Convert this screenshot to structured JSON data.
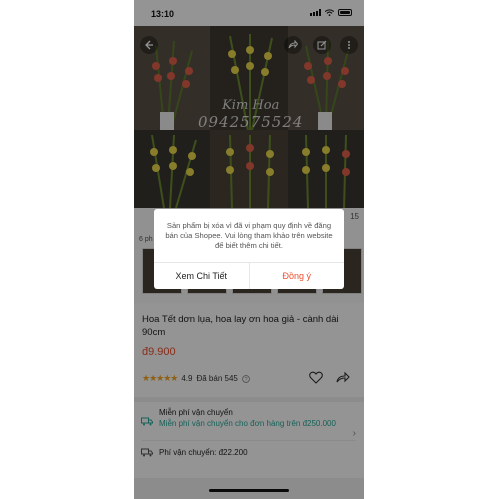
{
  "status_bar": {
    "time": "13:10"
  },
  "gallery": {
    "watermark_name": "Kim Hoa",
    "watermark_phone": "0942575524",
    "image_count": "15",
    "strip_label": "6 ph"
  },
  "product": {
    "title": "Hoa Tết dơn lụa, hoa lay ơn hoa giả - cành dài 90cm",
    "price": "đ9.900",
    "rating": "4.9",
    "sold": "Đã bán 545"
  },
  "shipping": {
    "free_title": "Miễn phí vận chuyển",
    "free_detail": "Miễn phí vận chuyển cho đơn hàng trên đ250.000",
    "fee": "Phí vận chuyển: đ22.200"
  },
  "dialog": {
    "message": "Sản phẩm bị xóa vì đã vi phạm quy định về đăng bán của Shopee. Vui lòng tham khảo trên website để biết thêm chi tiết.",
    "detail_label": "Xem Chi Tiết",
    "confirm_label": "Đồng ý"
  },
  "colors": {
    "brand": "#ee4d2d",
    "teal": "#26aa99",
    "star": "#f5a623"
  }
}
